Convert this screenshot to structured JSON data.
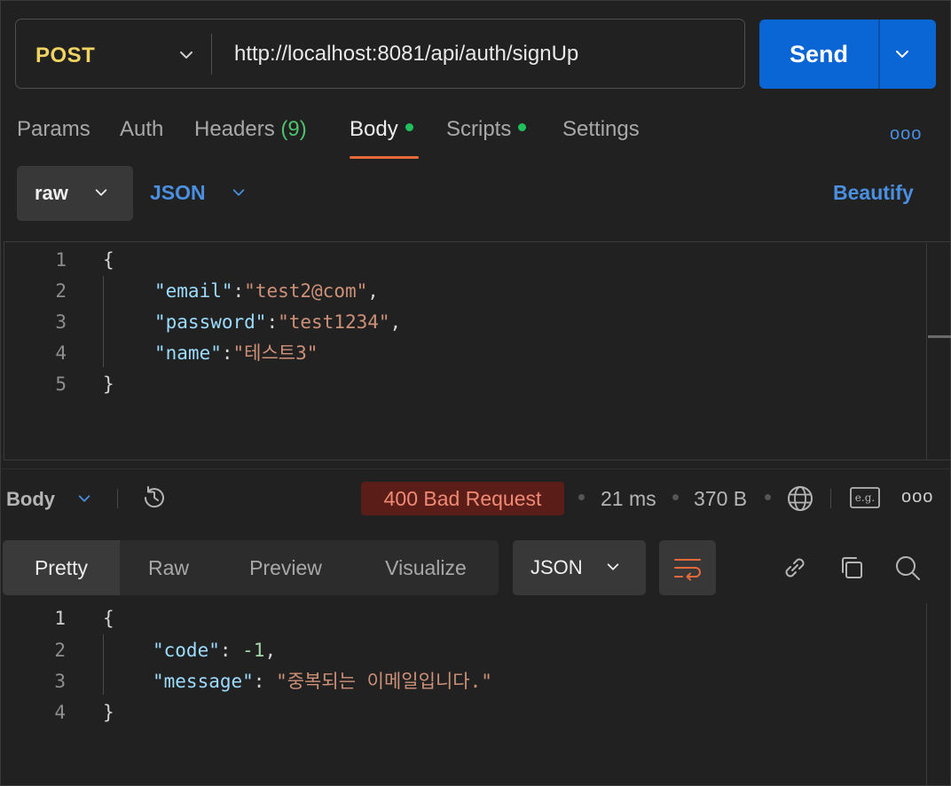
{
  "request": {
    "method": "POST",
    "url": "http://localhost:8081/api/auth/signUp",
    "send_label": "Send"
  },
  "tabs": [
    {
      "label": "Params"
    },
    {
      "label": "Auth"
    },
    {
      "label": "Headers",
      "count": "(9)"
    },
    {
      "label": "Body",
      "active": true,
      "dot": true
    },
    {
      "label": "Scripts",
      "dot": true
    },
    {
      "label": "Settings"
    }
  ],
  "more_label": "ooo",
  "body_options": {
    "mode": "raw",
    "language": "JSON",
    "beautify_label": "Beautify"
  },
  "request_body": {
    "line_numbers": [
      "1",
      "2",
      "3",
      "4",
      "5"
    ],
    "open": "{",
    "close": "}",
    "fields": [
      {
        "key": "\"email\"",
        "value": "\"test2@com\"",
        "sep": ",",
        "colon": ":"
      },
      {
        "key": "\"password\"",
        "value": "\"test1234\"",
        "sep": ",",
        "colon": ":"
      },
      {
        "key": "\"name\"",
        "value": "\"테스트3\"",
        "sep": "",
        "colon": ":"
      }
    ]
  },
  "response": {
    "section_label": "Body",
    "status": "400 Bad Request",
    "time": "21 ms",
    "size": "370 B",
    "example_label": "e.g.",
    "view_tabs": [
      {
        "label": "Pretty",
        "active": true
      },
      {
        "label": "Raw"
      },
      {
        "label": "Preview"
      },
      {
        "label": "Visualize"
      }
    ],
    "format": "JSON",
    "body": {
      "line_numbers": [
        "1",
        "2",
        "3",
        "4"
      ],
      "open": "{",
      "close": "}",
      "code_key": "\"code\"",
      "code_value": "-1",
      "message_key": "\"message\"",
      "message_value": "\"중복되는 이메일입니다.\""
    }
  },
  "colors": {
    "send": "#0a66d4",
    "method": "#f0d462",
    "status_bg": "#5b1d18",
    "status_text": "#f08a74",
    "accent_link": "#4a8fe0",
    "active_tab_underline": "#e8693a",
    "dot": "#20c05c"
  }
}
